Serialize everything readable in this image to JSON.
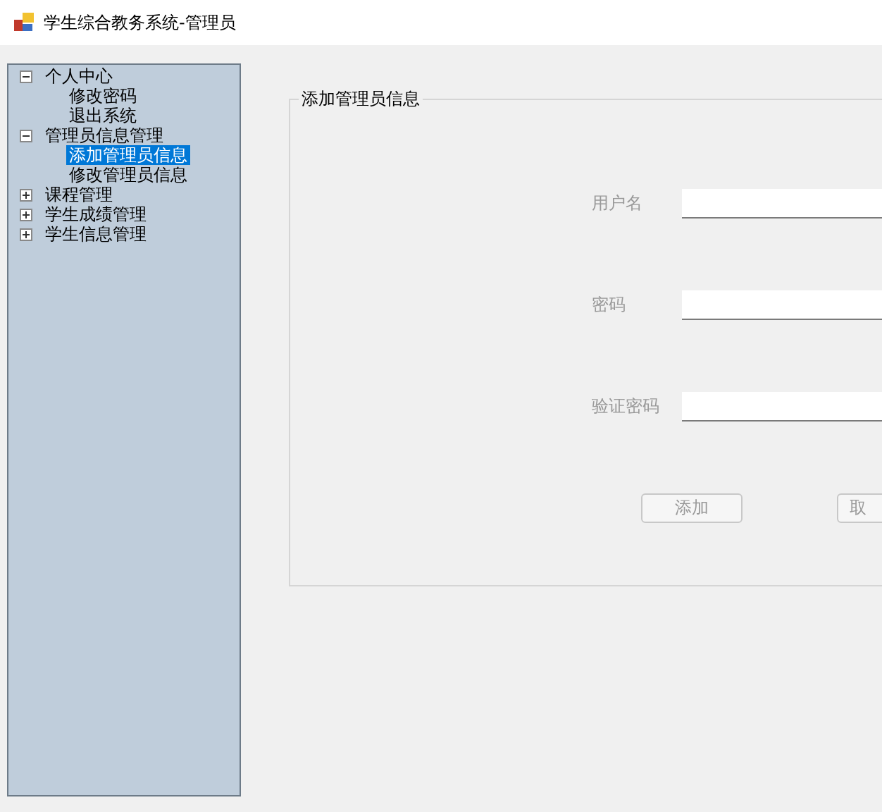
{
  "window": {
    "title": "学生综合教务系统-管理员"
  },
  "tree": [
    {
      "label": "个人中心",
      "expanded": true,
      "children": [
        {
          "label": "修改密码",
          "selected": false
        },
        {
          "label": "退出系统",
          "selected": false
        }
      ]
    },
    {
      "label": "管理员信息管理",
      "expanded": true,
      "children": [
        {
          "label": "添加管理员信息",
          "selected": true
        },
        {
          "label": "修改管理员信息",
          "selected": false
        }
      ]
    },
    {
      "label": "课程管理",
      "expanded": false
    },
    {
      "label": "学生成绩管理",
      "expanded": false
    },
    {
      "label": "学生信息管理",
      "expanded": false
    }
  ],
  "form": {
    "title": "添加管理员信息",
    "disabled": true,
    "fields": [
      {
        "label": "用户名"
      },
      {
        "label": "密码"
      },
      {
        "label": "验证密码"
      }
    ],
    "buttons": [
      "添加",
      "取"
    ]
  }
}
